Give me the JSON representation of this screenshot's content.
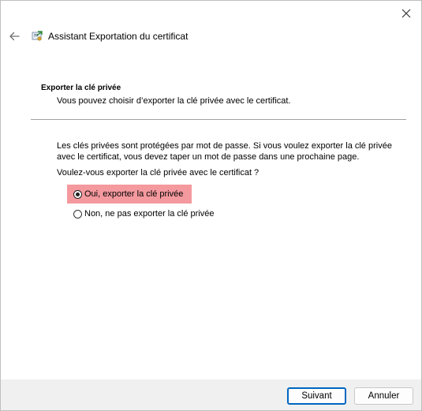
{
  "window": {
    "title": "Assistant Exportation du certificat",
    "icons": {
      "close": "close-icon",
      "back": "back-arrow-icon",
      "app": "certificate-wizard-icon"
    }
  },
  "header": {
    "section_title": "Exporter la clé privée",
    "section_subtitle": "Vous pouvez choisir d’exporter la clé privée avec le certificat."
  },
  "body": {
    "info_text": "Les clés privées sont protégées par mot de passe. Si vous voulez exporter la clé privée avec le certificat, vous devez taper un mot de passe dans une prochaine page.",
    "question": "Voulez-vous exporter la clé privée avec le certificat ?",
    "options": [
      {
        "label": "Oui, exporter la clé privée",
        "selected": true,
        "highlight_color": "#f4999e"
      },
      {
        "label": "Non, ne pas exporter la clé privée",
        "selected": false
      }
    ]
  },
  "footer": {
    "next_label": "Suivant",
    "cancel_label": "Annuler",
    "accent_color": "#0067c0"
  }
}
